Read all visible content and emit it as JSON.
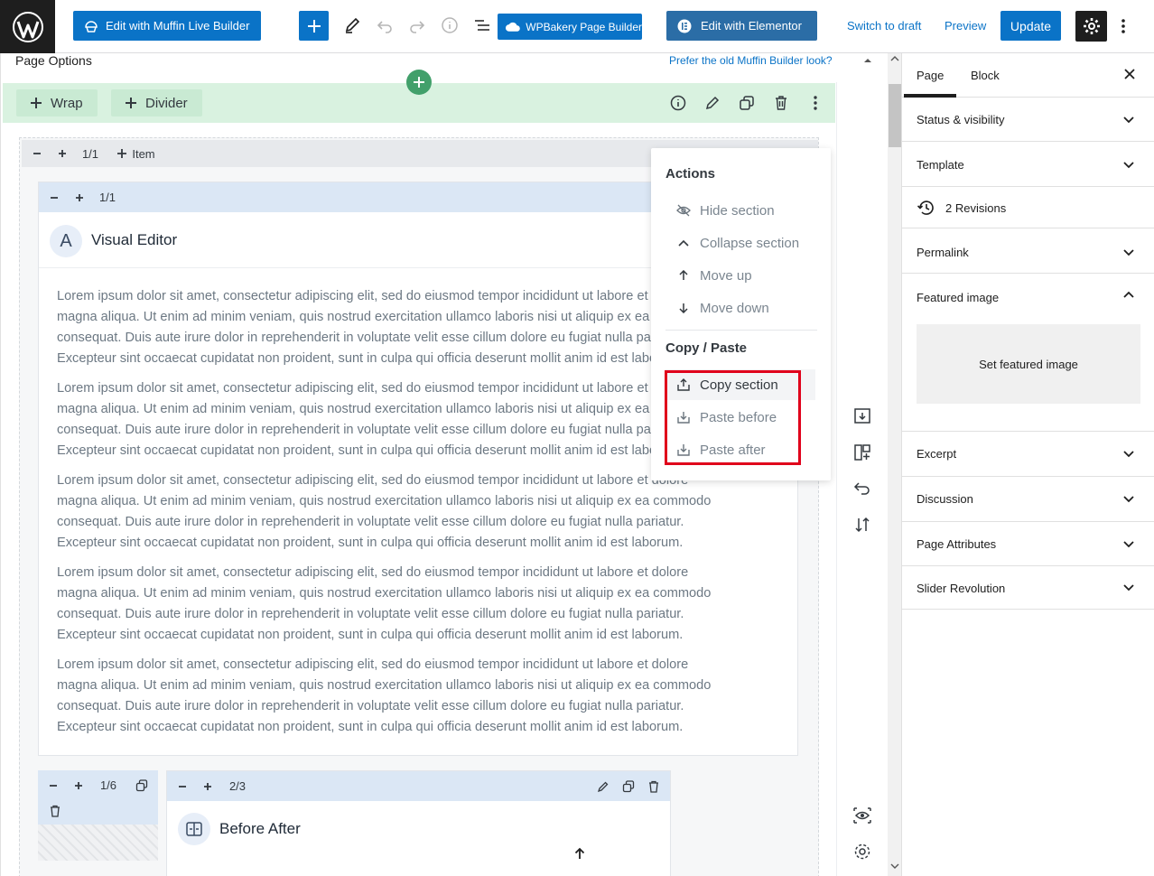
{
  "topbar": {
    "muffin_live_label": "Edit with Muffin Live Builder",
    "wpbakery_label": "WPBakery Page Builder",
    "elementor_label": "Edit with Elementor",
    "switch_draft_label": "Switch to draft",
    "preview_label": "Preview",
    "update_label": "Update"
  },
  "editor": {
    "page_options_title": "Page Options",
    "old_look_link": "Prefer the old Muffin Builder look?",
    "section_bar": {
      "wrap_label": "Wrap",
      "divider_label": "Divider"
    },
    "wrap": {
      "size": "1/1",
      "item_label": "Item"
    },
    "visual_editor": {
      "size": "1/1",
      "icon_letter": "A",
      "title": "Visual Editor",
      "paragraphs": [
        "Lorem ipsum dolor sit amet, consectetur adipiscing elit, sed do eiusmod tempor incididunt ut labore et dolore\nmagna aliqua. Ut enim ad minim veniam, quis nostrud exercitation ullamco laboris nisi ut aliquip ex ea commodo\nconsequat. Duis aute irure dolor in reprehenderit in voluptate velit esse cillum dolore eu fugiat nulla pariatur.\nExcepteur sint occaecat cupidatat non proident, sunt in culpa qui officia deserunt mollit anim id est laborum.",
        "Lorem ipsum dolor sit amet, consectetur adipiscing elit, sed do eiusmod tempor incididunt ut labore et dolore\nmagna aliqua. Ut enim ad minim veniam, quis nostrud exercitation ullamco laboris nisi ut aliquip ex ea commodo\nconsequat. Duis aute irure dolor in reprehenderit in voluptate velit esse cillum dolore eu fugiat nulla pariatur.\nExcepteur sint occaecat cupidatat non proident, sunt in culpa qui officia deserunt mollit anim id est laborum.",
        "Lorem ipsum dolor sit amet, consectetur adipiscing elit, sed do eiusmod tempor incididunt ut labore et dolore\nmagna aliqua. Ut enim ad minim veniam, quis nostrud exercitation ullamco laboris nisi ut aliquip ex ea commodo\nconsequat. Duis aute irure dolor in reprehenderit in voluptate velit esse cillum dolore eu fugiat nulla pariatur.\nExcepteur sint occaecat cupidatat non proident, sunt in culpa qui officia deserunt mollit anim id est laborum.",
        "Lorem ipsum dolor sit amet, consectetur adipiscing elit, sed do eiusmod tempor incididunt ut labore et dolore\nmagna aliqua. Ut enim ad minim veniam, quis nostrud exercitation ullamco laboris nisi ut aliquip ex ea commodo\nconsequat. Duis aute irure dolor in reprehenderit in voluptate velit esse cillum dolore eu fugiat nulla pariatur.\nExcepteur sint occaecat cupidatat non proident, sunt in culpa qui officia deserunt mollit anim id est laborum.",
        "Lorem ipsum dolor sit amet, consectetur adipiscing elit, sed do eiusmod tempor incididunt ut labore et dolore\nmagna aliqua. Ut enim ad minim veniam, quis nostrud exercitation ullamco laboris nisi ut aliquip ex ea commodo\nconsequat. Duis aute irure dolor in reprehenderit in voluptate velit esse cillum dolore eu fugiat nulla pariatur.\nExcepteur sint occaecat cupidatat non proident, sunt in culpa qui officia deserunt mollit anim id est laborum."
      ]
    },
    "col_small_size": "1/6",
    "col_large_size": "2/3",
    "before_after_title": "Before After",
    "actions_menu": {
      "actions_heading": "Actions",
      "hide_section": "Hide section",
      "collapse_section": "Collapse section",
      "move_up": "Move up",
      "move_down": "Move down",
      "copy_paste_heading": "Copy / Paste",
      "copy_section": "Copy section",
      "paste_before": "Paste before",
      "paste_after": "Paste after"
    }
  },
  "sidebar": {
    "tab_page": "Page",
    "tab_block": "Block",
    "status_visibility": "Status & visibility",
    "template": "Template",
    "revisions": "2 Revisions",
    "permalink": "Permalink",
    "featured_image": "Featured image",
    "set_featured_image": "Set featured image",
    "excerpt": "Excerpt",
    "discussion": "Discussion",
    "page_attributes": "Page Attributes",
    "slider_revolution": "Slider Revolution"
  },
  "colors": {
    "wp_blue": "#0a73c7",
    "section_green": "#d9f2e0",
    "add_green": "#42a06b",
    "highlight_red": "#e0001b"
  }
}
